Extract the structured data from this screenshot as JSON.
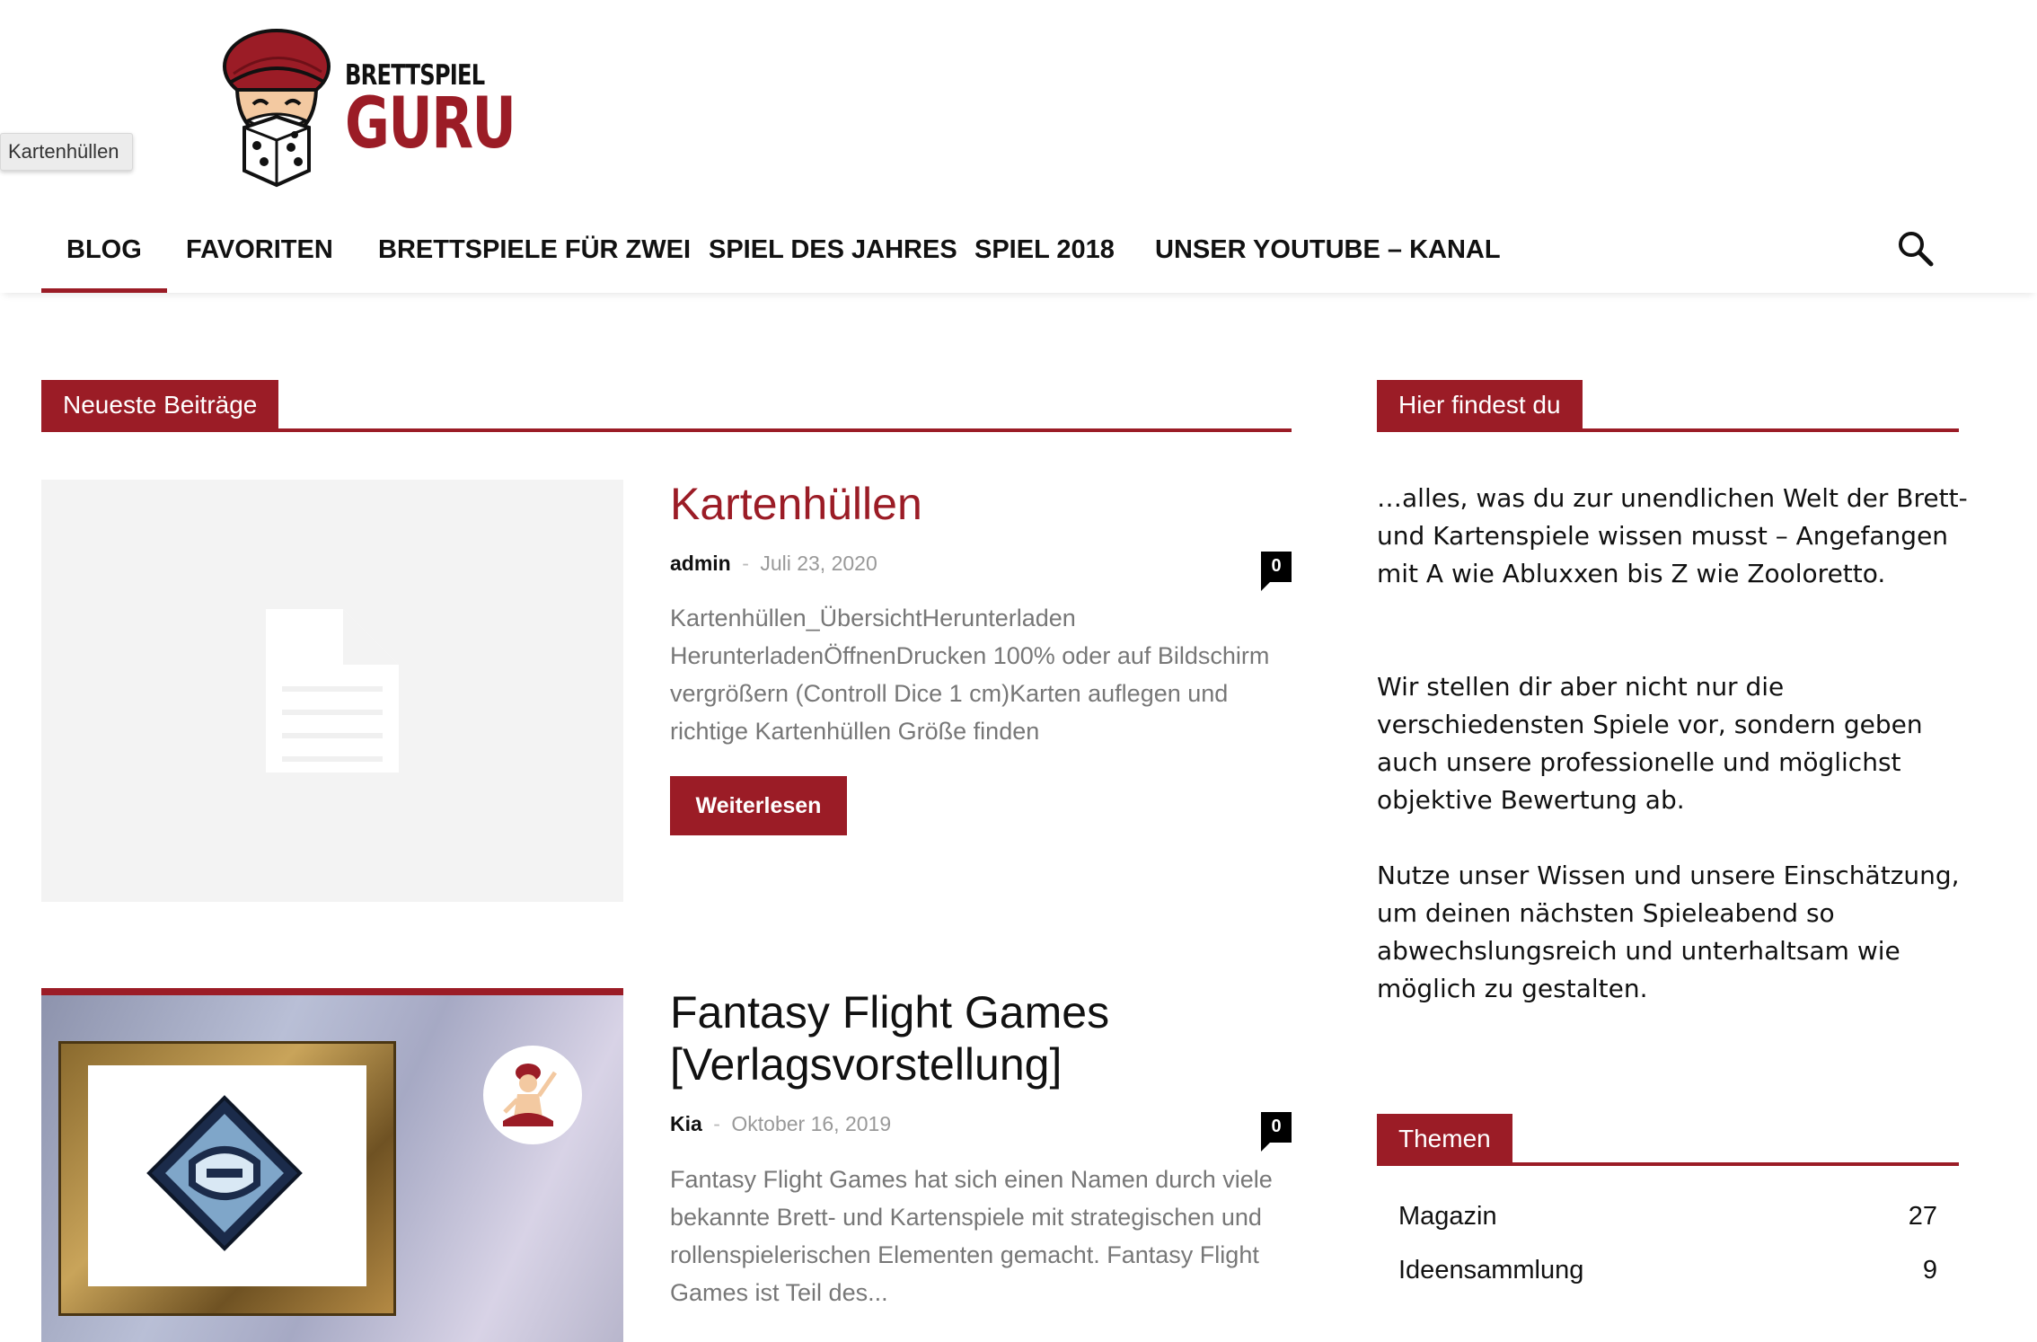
{
  "tooltip": "Kartenhüllen",
  "logo": {
    "top": "BRETTSPIEL",
    "big": "GURU"
  },
  "nav": {
    "items": [
      "BLOG",
      "FAVORITEN",
      "BRETTSPIELE FÜR ZWEI",
      "SPIEL DES JAHRES",
      "SPIEL 2018",
      "UNSER YOUTUBE – KANAL"
    ],
    "active_index": 0,
    "search_icon": "search-icon"
  },
  "latest": {
    "title": "Neueste Beiträge",
    "posts": [
      {
        "title": "Kartenhüllen",
        "author": "admin",
        "sep": "-",
        "date": "Juli 23, 2020",
        "comments": "0",
        "excerpt": "Kartenhüllen_ÜbersichtHerunterladen HerunterladenÖffnenDrucken 100% oder auf Bildschirm vergrößern (Controll Dice 1 cm)Karten auflegen und richtige Kartenhüllen Größe finden",
        "read_more": "Weiterlesen",
        "thumb_icon": "document-placeholder-icon"
      },
      {
        "title_line1": "Fantasy Flight Games",
        "title_line2": "[Verlagsvorstellung]",
        "author": "Kia",
        "sep": "-",
        "date": "Oktober 16, 2019",
        "comments": "0",
        "excerpt": "Fantasy Flight Games hat sich einen Namen durch viele bekannte Brett- und Kartenspiele mit strategischen und rollenspielerischen Elementen gemacht. Fantasy Flight Games ist Teil des..."
      }
    ]
  },
  "sidebar": {
    "about_title": "Hier findest du",
    "para1": "…alles, was du zur unendlichen Welt der Brett- und Kartenspiele wissen musst – Angefangen mit A wie Abluxxen bis Z wie Zooloretto.",
    "para2": "Wir stellen dir aber nicht nur die verschiedensten Spiele vor, sondern geben auch unsere professionelle und möglichst objektive Bewertung ab.",
    "para3": "Nutze unser Wissen und unsere Einschätzung, um deinen nächsten Spieleabend so abwechslungsreich und unterhaltsam wie möglich zu gestalten.",
    "themes_title": "Themen",
    "themes": [
      {
        "name": "Magazin",
        "count": "27"
      },
      {
        "name": "Ideensammlung",
        "count": "9"
      }
    ]
  },
  "colors": {
    "accent": "#9b1c26",
    "text": "#111111",
    "muted": "#777777"
  }
}
